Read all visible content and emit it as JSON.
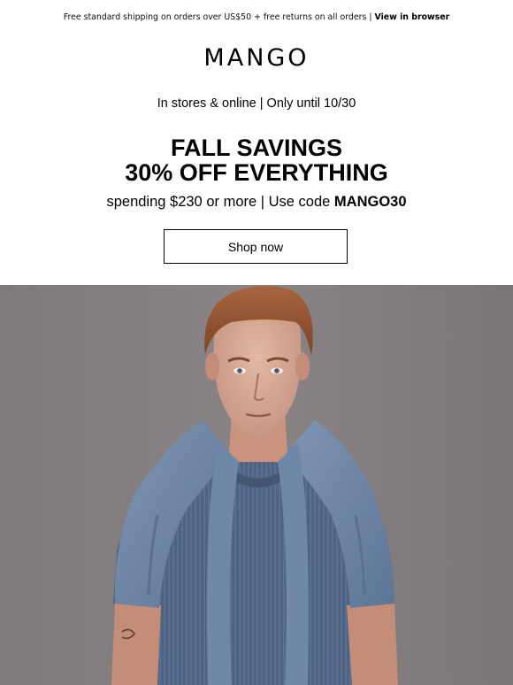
{
  "preheader": {
    "text": "Free standard shipping on orders over US$50 + free returns on all orders | ",
    "link_label": "View in browser"
  },
  "brand": {
    "logo_text": "MANGO"
  },
  "promo": {
    "availability": "In stores & online | Only until 10/30",
    "headline_line1": "FALL SAVINGS",
    "headline_line2": "30% OFF EVERYTHING",
    "condition_text": "spending $230 or more | Use code ",
    "code": "MANGO30",
    "cta_label": "Shop now"
  },
  "hero": {
    "icon": "model-photo",
    "background_color": "#807b7d"
  }
}
